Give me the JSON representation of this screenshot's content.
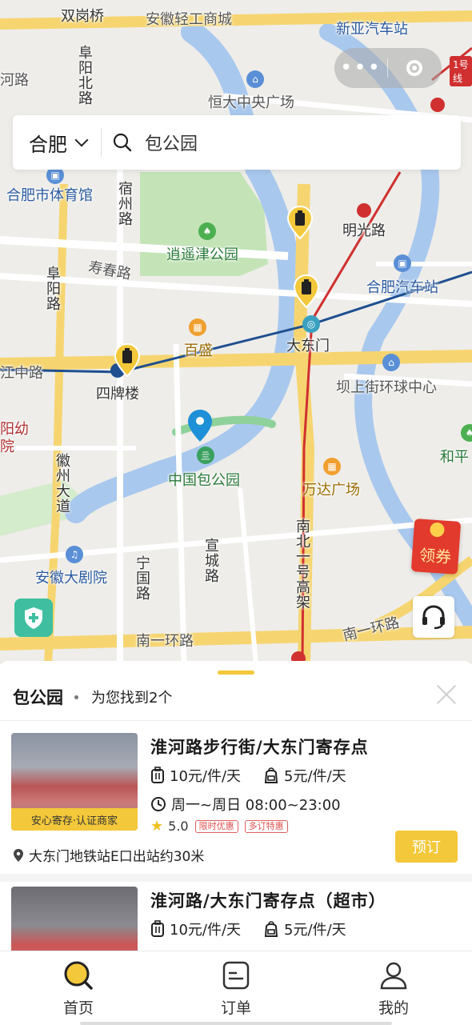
{
  "map": {
    "labels": {
      "shuanggangqiao": "双岗桥",
      "anhui_light": "安徽轻工商城",
      "xinya_bus": "新亚汽车站",
      "fuyang_north": "阜阳北路",
      "hengda": "恒大中央广场",
      "he_road": "河路",
      "hefei_stadium": "合肥市体育馆",
      "suzhou_road": "宿州路",
      "xiaoyaojin": "逍遥津公园",
      "mingguang": "明光路",
      "bus_station": "合肥汽车站",
      "shouchun": "寿春路",
      "fuyang_road": "阜阳路",
      "baisheng": "百盛",
      "dadongmen": "大东门",
      "jiang_road": "江中路",
      "sipailou": "四牌楼",
      "bashang": "坝上街环球中心",
      "hepin": "和平",
      "baogong": "中国包公园",
      "wanda": "万达广场",
      "huizhou": "徽州大道",
      "nanbei": "南北一号高架",
      "theatre": "安徽大剧院",
      "ningguo": "宁国路",
      "xuancheng": "宣城路",
      "nanyi_left": "南一环路",
      "nanyi_right": "南一环路",
      "yang_you": "阳幼",
      "yuan": "院",
      "line1": "1号线"
    },
    "coupon_label": "领券"
  },
  "search": {
    "city": "合肥",
    "query": "包公园"
  },
  "results": {
    "keyword": "包公园",
    "count_text": "为您找到2个",
    "items": [
      {
        "title": "淮河路步行街/大东门寄存点",
        "price_piece": "10元/件/天",
        "price_bag": "5元/件/天",
        "hours": "周一~周日 08:00~23:00",
        "tag": "安心寄存·认证商家",
        "rating": "5.0",
        "badge1": "限时优惠",
        "badge2": "多订特惠",
        "address": "大东门地铁站E口出站约30米",
        "book_label": "预订"
      },
      {
        "title": "淮河路/大东门寄存点（超市）",
        "price_piece": "10元/件/天",
        "price_bag": "5元/件/天"
      }
    ]
  },
  "tabs": [
    {
      "label": "首页"
    },
    {
      "label": "订单"
    },
    {
      "label": "我的"
    }
  ],
  "colors": {
    "accent": "#f3c83a",
    "river": "#a9c8ee",
    "park": "#bfe3b4",
    "metro_line": "#1f4f8f",
    "rail_line": "#d03030"
  }
}
